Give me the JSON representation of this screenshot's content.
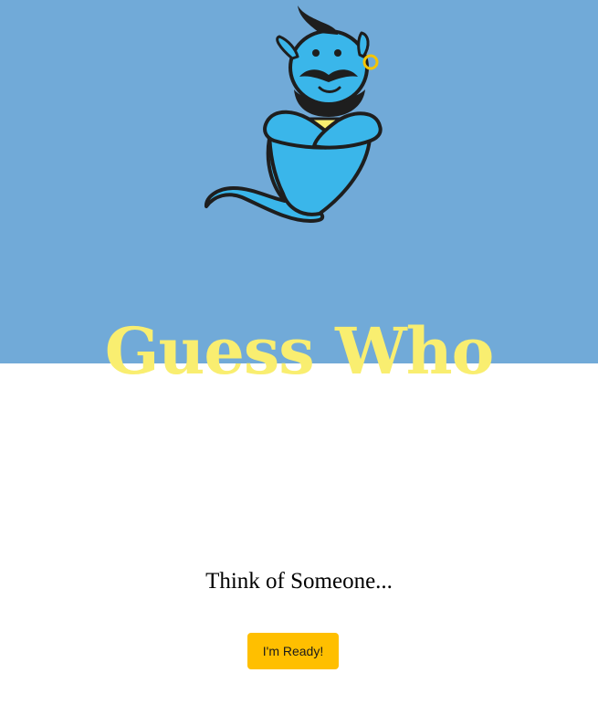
{
  "hero": {
    "background_color": "#71aad8",
    "mascot_icon": "genie-icon"
  },
  "title": {
    "text": "Guess Who",
    "color": "#f9ee70"
  },
  "prompt": {
    "text": "Think of Someone..."
  },
  "ready_button": {
    "label": "I'm Ready!",
    "color": "#ffbf00"
  }
}
